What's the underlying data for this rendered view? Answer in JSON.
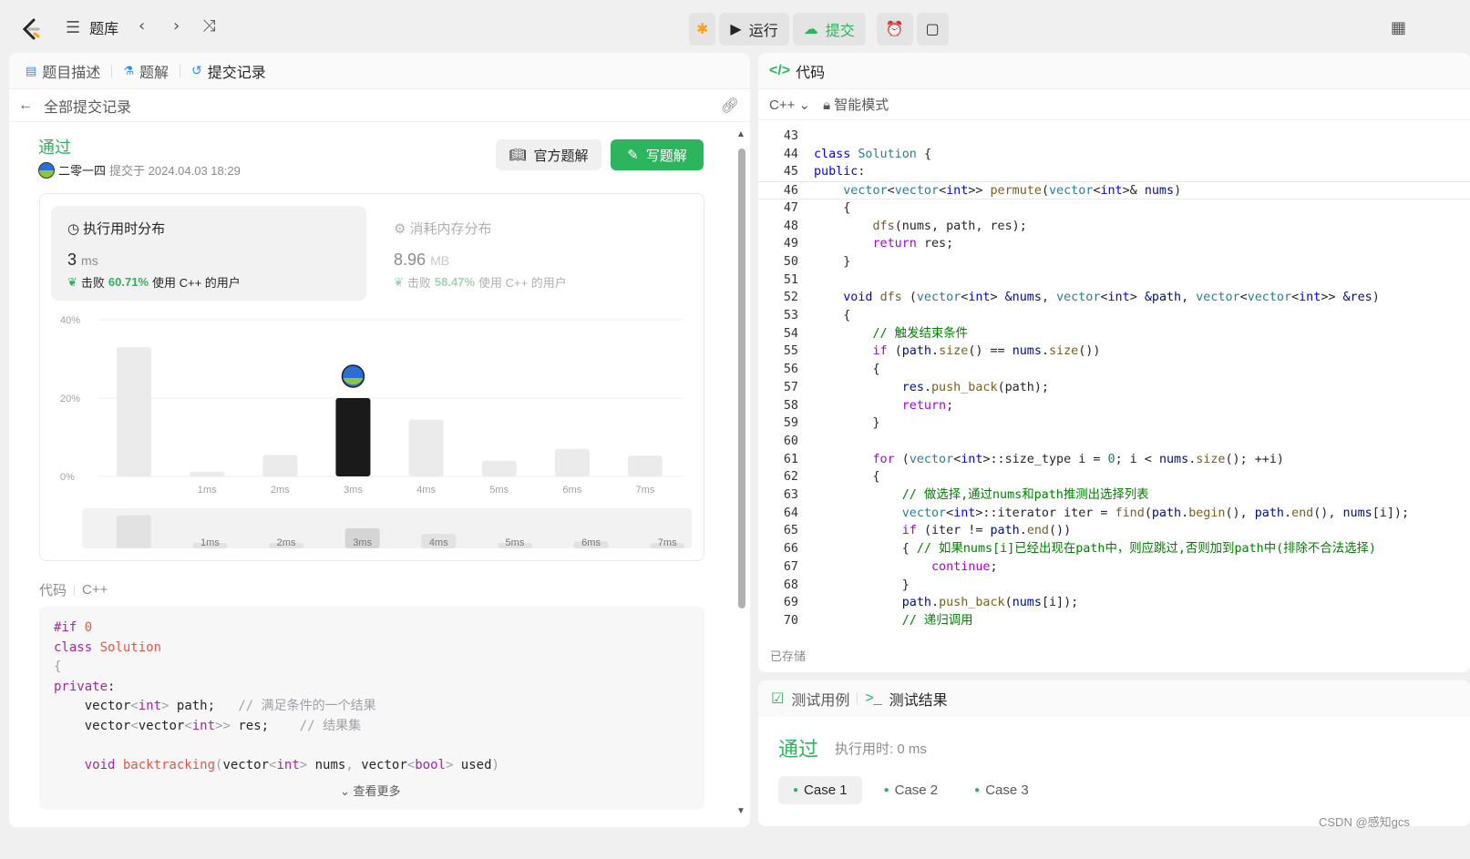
{
  "topbar": {
    "problem_bank": "题库",
    "run": "运行",
    "submit": "提交"
  },
  "left_tabs": [
    "题目描述",
    "题解",
    "提交记录"
  ],
  "subheader": {
    "back_label": "全部提交记录"
  },
  "submission": {
    "status": "通过",
    "user": "二零一四",
    "submitted_at": "提交于 2024.04.03 18:29",
    "official_btn": "官方题解",
    "write_btn": "写题解"
  },
  "runtime_card": {
    "title": "执行用时分布",
    "value": "3",
    "unit": "ms",
    "beat_prefix": "击败",
    "beat_pct": "60.71%",
    "beat_suffix": "使用 C++ 的用户"
  },
  "memory_card": {
    "title": "消耗内存分布",
    "value": "8.96",
    "unit": "MB",
    "beat_prefix": "击败",
    "beat_pct": "58.47%",
    "beat_suffix": "使用 C++ 的用户"
  },
  "chart_data": {
    "type": "bar",
    "categories": [
      "",
      "1ms",
      "2ms",
      "3ms",
      "4ms",
      "5ms",
      "6ms",
      "7ms"
    ],
    "values": [
      33,
      1.2,
      5.5,
      20,
      14.5,
      4,
      7,
      5.3
    ],
    "highlight_index": 3,
    "ylim": [
      0,
      40
    ],
    "yticks": [
      "0%",
      "20%",
      "40%"
    ],
    "colors": {
      "bar": "#ebebeb",
      "highlight": "#1a1a1a"
    },
    "slider_categories": [
      "1ms",
      "2ms",
      "3ms",
      "4ms",
      "5ms",
      "6ms",
      "7ms"
    ]
  },
  "code_section": {
    "label": "代码",
    "lang": "C++",
    "more": "查看更多",
    "lines": [
      [
        [
          "ckw",
          "#if "
        ],
        [
          "cfn",
          "0"
        ]
      ],
      [
        [
          "ckw",
          "class "
        ],
        [
          "cfn",
          "Solution"
        ]
      ],
      [
        [
          "ccm",
          "{"
        ]
      ],
      [
        [
          "ckw",
          "private"
        ],
        [
          "op",
          ":"
        ]
      ],
      [
        [
          "op",
          "    vector"
        ],
        [
          "ccm",
          "<"
        ],
        [
          "ckw",
          "int"
        ],
        [
          "ccm",
          "> "
        ],
        [
          "op",
          "path;   "
        ],
        [
          "ccm",
          "// 满足条件的一个结果"
        ]
      ],
      [
        [
          "op",
          "    vector"
        ],
        [
          "ccm",
          "<"
        ],
        [
          "op",
          "vector"
        ],
        [
          "ccm",
          "<"
        ],
        [
          "ckw",
          "int"
        ],
        [
          "ccm",
          ">> "
        ],
        [
          "op",
          "res;    "
        ],
        [
          "ccm",
          "// 结果集"
        ]
      ],
      [
        [
          "op",
          ""
        ]
      ],
      [
        [
          "ckw",
          "    void "
        ],
        [
          "cfn",
          "backtracking"
        ],
        [
          "ccm",
          "("
        ],
        [
          "op",
          "vector"
        ],
        [
          "ccm",
          "<"
        ],
        [
          "ckw",
          "int"
        ],
        [
          "ccm",
          "> "
        ],
        [
          "op",
          "nums"
        ],
        [
          "ccm",
          ", "
        ],
        [
          "op",
          "vector"
        ],
        [
          "ccm",
          "<"
        ],
        [
          "ckw",
          "bool"
        ],
        [
          "ccm",
          "> "
        ],
        [
          "op",
          "used"
        ],
        [
          "ccm",
          ")"
        ]
      ]
    ]
  },
  "editor": {
    "title": "代码",
    "lang": "C++",
    "mode": "智能模式",
    "saved": "已存储",
    "lines": [
      {
        "n": "43",
        "t": []
      },
      {
        "n": "44",
        "t": [
          [
            "kw",
            "class "
          ],
          [
            "ty",
            "Solution "
          ],
          [
            "op",
            "{"
          ]
        ]
      },
      {
        "n": "45",
        "t": [
          [
            "kw",
            "public"
          ],
          [
            "op",
            ":"
          ]
        ]
      },
      {
        "n": "46",
        "t": [
          [
            "op",
            "    "
          ],
          [
            "ty",
            "vector"
          ],
          [
            "op",
            "<"
          ],
          [
            "ty",
            "vector"
          ],
          [
            "op",
            "<"
          ],
          [
            "kw",
            "int"
          ],
          [
            "op",
            ">> "
          ],
          [
            "fn",
            "permute"
          ],
          [
            "op",
            "("
          ],
          [
            "ty",
            "vector"
          ],
          [
            "op",
            "<"
          ],
          [
            "kw",
            "int"
          ],
          [
            "op",
            ">& "
          ],
          [
            "var",
            "nums"
          ],
          [
            "op",
            ")"
          ]
        ]
      },
      {
        "n": "47",
        "t": [
          [
            "op",
            "    {"
          ]
        ]
      },
      {
        "n": "48",
        "t": [
          [
            "op",
            "        "
          ],
          [
            "fn",
            "dfs"
          ],
          [
            "op",
            "(nums, path, res);"
          ]
        ]
      },
      {
        "n": "49",
        "t": [
          [
            "ctrl",
            "        return "
          ],
          [
            "op",
            "res;"
          ]
        ]
      },
      {
        "n": "50",
        "t": [
          [
            "op",
            "    }"
          ]
        ]
      },
      {
        "n": "51",
        "t": []
      },
      {
        "n": "52",
        "t": [
          [
            "kw",
            "    void "
          ],
          [
            "fn",
            "dfs "
          ],
          [
            "op",
            "("
          ],
          [
            "ty",
            "vector"
          ],
          [
            "op",
            "<"
          ],
          [
            "kw",
            "int"
          ],
          [
            "op",
            "> "
          ],
          [
            "var",
            "&nums"
          ],
          [
            "op",
            ", "
          ],
          [
            "ty",
            "vector"
          ],
          [
            "op",
            "<"
          ],
          [
            "kw",
            "int"
          ],
          [
            "op",
            "> "
          ],
          [
            "var",
            "&path"
          ],
          [
            "op",
            ", "
          ],
          [
            "ty",
            "vector"
          ],
          [
            "op",
            "<"
          ],
          [
            "ty",
            "vector"
          ],
          [
            "op",
            "<"
          ],
          [
            "kw",
            "int"
          ],
          [
            "op",
            ">> "
          ],
          [
            "var",
            "&res"
          ],
          [
            "op",
            ")"
          ]
        ]
      },
      {
        "n": "53",
        "t": [
          [
            "op",
            "    {"
          ]
        ]
      },
      {
        "n": "54",
        "t": [
          [
            "cm",
            "        // 触发结束条件"
          ]
        ]
      },
      {
        "n": "55",
        "t": [
          [
            "ctrl",
            "        if "
          ],
          [
            "op",
            "("
          ],
          [
            "var",
            "path"
          ],
          [
            "op",
            "."
          ],
          [
            "fn",
            "size"
          ],
          [
            "op",
            "() == "
          ],
          [
            "var",
            "nums"
          ],
          [
            "op",
            "."
          ],
          [
            "fn",
            "size"
          ],
          [
            "op",
            "())"
          ]
        ]
      },
      {
        "n": "56",
        "t": [
          [
            "op",
            "        {"
          ]
        ]
      },
      {
        "n": "57",
        "t": [
          [
            "op",
            "            "
          ],
          [
            "var",
            "res"
          ],
          [
            "op",
            "."
          ],
          [
            "fn",
            "push_back"
          ],
          [
            "op",
            "(path);"
          ]
        ]
      },
      {
        "n": "58",
        "t": [
          [
            "ctrl",
            "            return"
          ],
          [
            "op",
            ";"
          ]
        ]
      },
      {
        "n": "59",
        "t": [
          [
            "op",
            "        }"
          ]
        ]
      },
      {
        "n": "60",
        "t": []
      },
      {
        "n": "61",
        "t": [
          [
            "ctrl",
            "        for "
          ],
          [
            "op",
            "("
          ],
          [
            "ty",
            "vector"
          ],
          [
            "op",
            "<"
          ],
          [
            "kw",
            "int"
          ],
          [
            "op",
            ">::size_type i = "
          ],
          [
            "num",
            "0"
          ],
          [
            "op",
            "; i < "
          ],
          [
            "var",
            "nums"
          ],
          [
            "op",
            "."
          ],
          [
            "fn",
            "size"
          ],
          [
            "op",
            "(); ++i)"
          ]
        ]
      },
      {
        "n": "62",
        "t": [
          [
            "op",
            "        {"
          ]
        ]
      },
      {
        "n": "63",
        "t": [
          [
            "cm",
            "            // 做选择,通过nums和path推测出选择列表"
          ]
        ]
      },
      {
        "n": "64",
        "t": [
          [
            "op",
            "            "
          ],
          [
            "ty",
            "vector"
          ],
          [
            "op",
            "<"
          ],
          [
            "kw",
            "int"
          ],
          [
            "op",
            ">::iterator iter = "
          ],
          [
            "fn",
            "find"
          ],
          [
            "op",
            "("
          ],
          [
            "var",
            "path"
          ],
          [
            "op",
            "."
          ],
          [
            "fn",
            "begin"
          ],
          [
            "op",
            "(), "
          ],
          [
            "var",
            "path"
          ],
          [
            "op",
            "."
          ],
          [
            "fn",
            "end"
          ],
          [
            "op",
            "(), "
          ],
          [
            "var",
            "nums"
          ],
          [
            "op",
            "[i]);"
          ]
        ]
      },
      {
        "n": "65",
        "t": [
          [
            "ctrl",
            "            if "
          ],
          [
            "op",
            "(iter != "
          ],
          [
            "var",
            "path"
          ],
          [
            "op",
            "."
          ],
          [
            "fn",
            "end"
          ],
          [
            "op",
            "())"
          ]
        ]
      },
      {
        "n": "66",
        "t": [
          [
            "op",
            "            { "
          ],
          [
            "cm",
            "// 如果nums[i]已经出现在path中，则应跳过,否则加到path中(排除不合法选择)"
          ]
        ]
      },
      {
        "n": "67",
        "t": [
          [
            "ctrl",
            "                continue"
          ],
          [
            "op",
            ";"
          ]
        ]
      },
      {
        "n": "68",
        "t": [
          [
            "op",
            "            }"
          ]
        ]
      },
      {
        "n": "69",
        "t": [
          [
            "op",
            "            "
          ],
          [
            "var",
            "path"
          ],
          [
            "op",
            "."
          ],
          [
            "fn",
            "push_back"
          ],
          [
            "op",
            "("
          ],
          [
            "var",
            "nums"
          ],
          [
            "op",
            "[i]);"
          ]
        ]
      },
      {
        "n": "70",
        "t": [
          [
            "cm",
            "            // 递归调用"
          ]
        ]
      }
    ]
  },
  "bottom": {
    "tab_testcase": "测试用例",
    "tab_result": "测试结果",
    "status": "通过",
    "runtime": "执行用时: 0 ms",
    "cases": [
      "Case 1",
      "Case 2",
      "Case 3"
    ]
  },
  "watermark": "CSDN @感知gcs"
}
